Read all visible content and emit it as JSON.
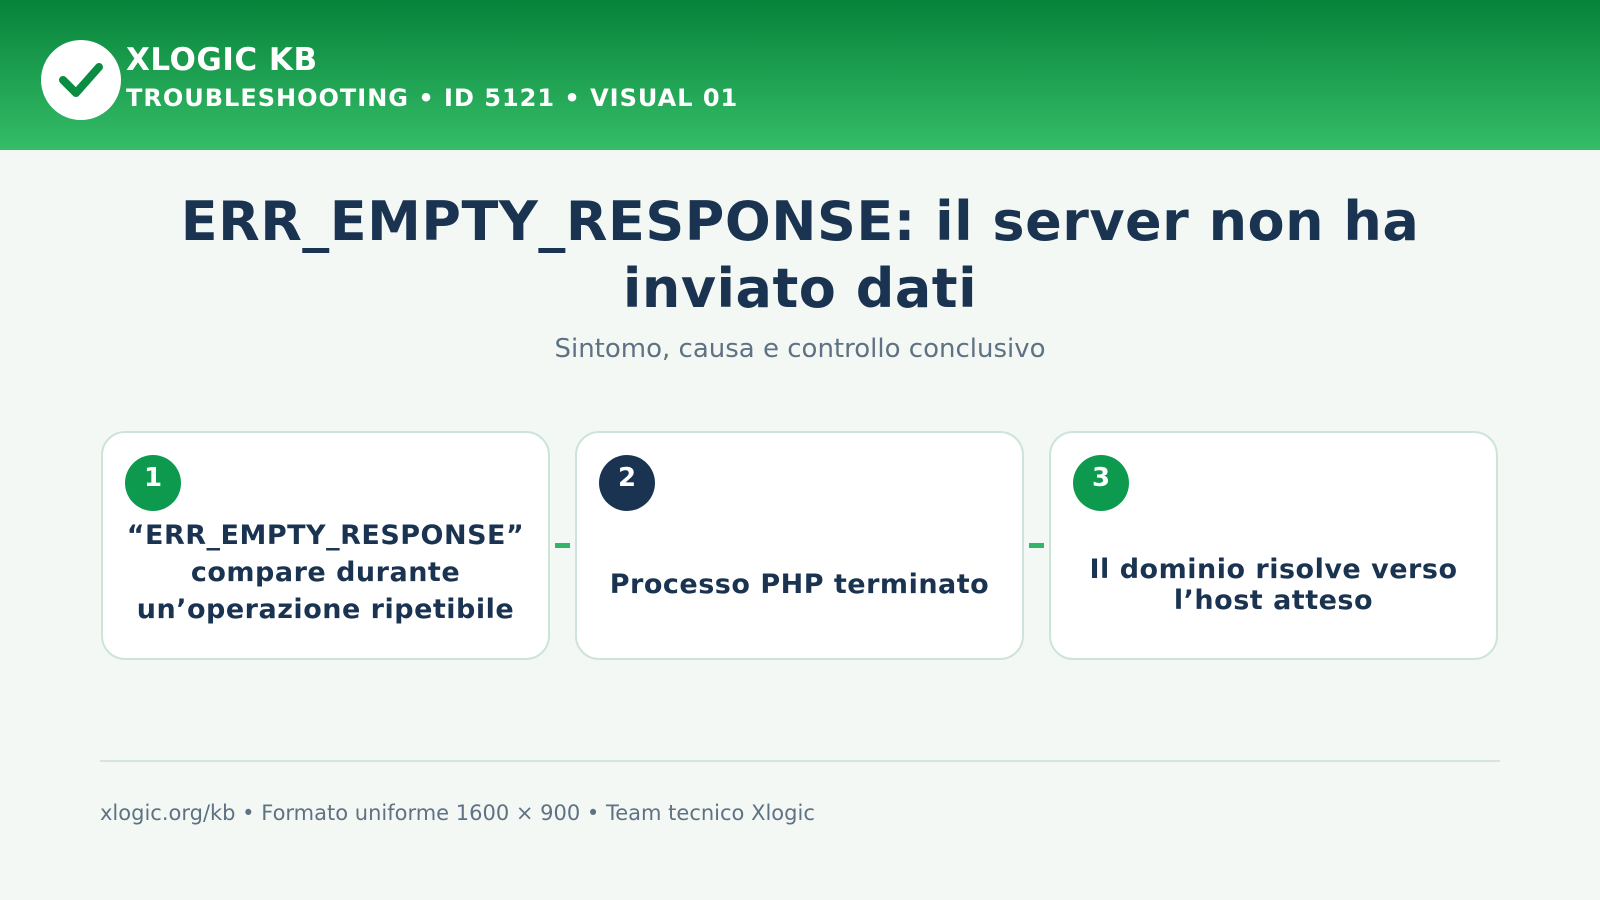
{
  "header": {
    "brand_title": "XLOGIC KB",
    "brand_subtitle": "TROUBLESHOOTING • ID 5121 • VISUAL 01",
    "logo_icon": "check-circle-icon",
    "colors": {
      "gradient_top": "#06833a",
      "gradient_bottom": "#35bd68"
    }
  },
  "main": {
    "title": "ERR_EMPTY_RESPONSE: il server non ha inviato dati",
    "subtitle": "Sintomo, causa e controllo conclusivo"
  },
  "steps": [
    {
      "number": "1",
      "text": "“ERR_EMPTY_RESPONSE” compare durante un’operazione ripetibile",
      "badge_color": "#0e9a4e"
    },
    {
      "number": "2",
      "text": "Processo PHP terminato",
      "badge_color": "#1a3350"
    },
    {
      "number": "3",
      "text": "Il dominio risolve verso l’host atteso",
      "badge_color": "#0e9a4e"
    }
  ],
  "footer": {
    "text": "xlogic.org/kb • Formato uniforme 1600 × 900 • Team tecnico Xlogic"
  }
}
